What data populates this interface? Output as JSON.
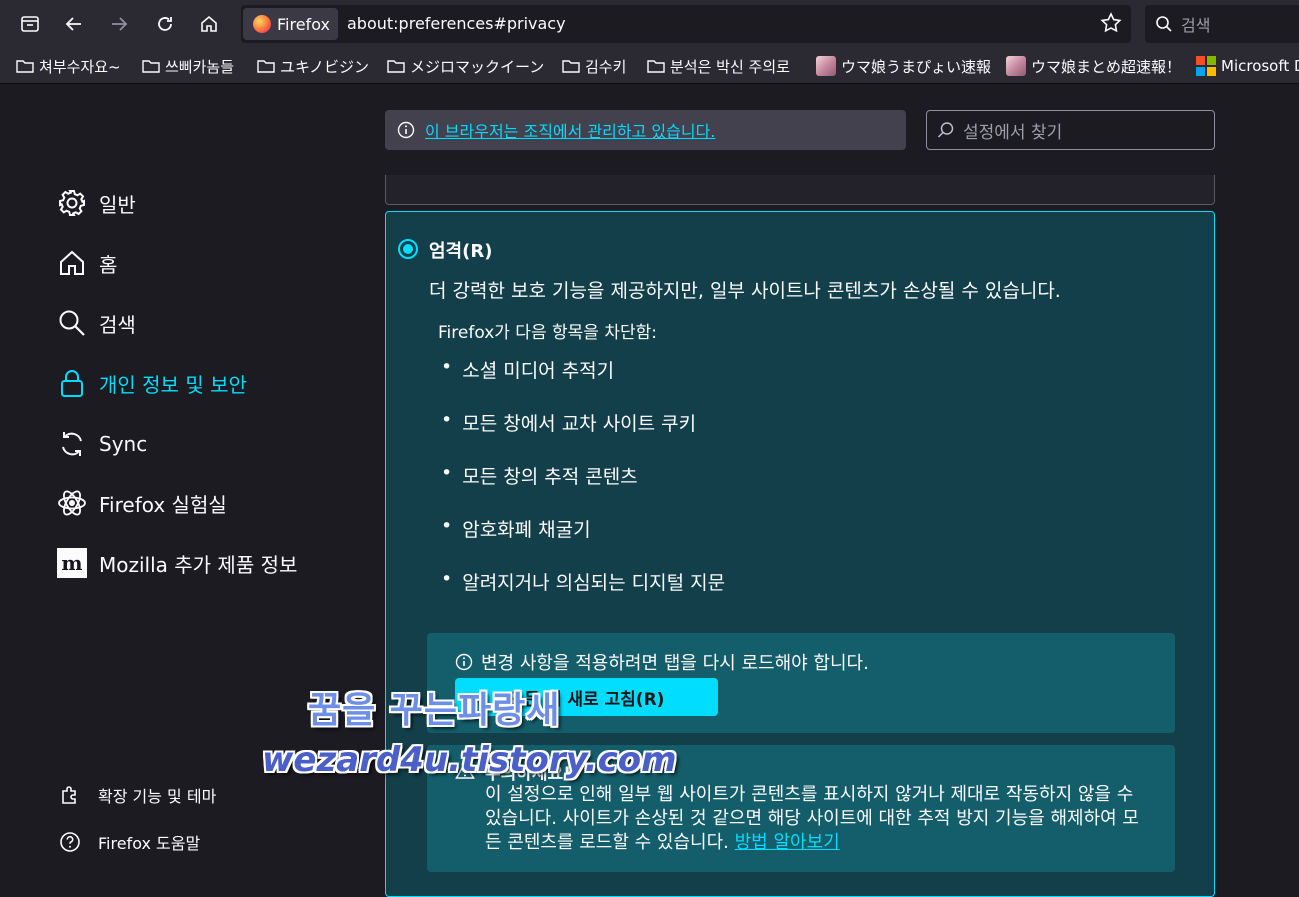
{
  "browser": {
    "identity_label": "Firefox",
    "url": "about:preferences#privacy",
    "search_placeholder": "검색"
  },
  "bookmarks": [
    {
      "label": "쳐부수자요~",
      "icon": "folder-icon"
    },
    {
      "label": "쓰삐카놈들",
      "icon": "folder-icon"
    },
    {
      "label": "ユキノビジン",
      "icon": "folder-icon"
    },
    {
      "label": "メジロマックイーン",
      "icon": "folder-icon"
    },
    {
      "label": "김수키",
      "icon": "folder-icon"
    },
    {
      "label": "분석은 박신 주의로",
      "icon": "folder-icon"
    },
    {
      "label": "ウマ娘うまぴょい速報",
      "icon": "favicon"
    },
    {
      "label": "ウマ娘まとめ超速報！",
      "icon": "favicon"
    },
    {
      "label": "Microsoft D",
      "icon": "microsoft-icon"
    }
  ],
  "policy_notice": "이 브라우저는 조직에서 관리하고 있습니다.",
  "pref_search_placeholder": "설정에서 찾기",
  "nav": {
    "items": [
      {
        "label": "일반",
        "icon": "gear-icon"
      },
      {
        "label": "홈",
        "icon": "home-icon"
      },
      {
        "label": "검색",
        "icon": "search-icon"
      },
      {
        "label": "개인 정보 및 보안",
        "icon": "lock-icon",
        "active": true
      },
      {
        "label": "Sync",
        "icon": "sync-icon"
      },
      {
        "label": "Firefox 실험실",
        "icon": "labs-icon"
      },
      {
        "label": "Mozilla 추가 제품 정보",
        "icon": "mozilla-icon"
      }
    ],
    "footer": [
      {
        "label": "확장 기능 및 테마",
        "icon": "puzzle-icon"
      },
      {
        "label": "Firefox 도움말",
        "icon": "help-icon"
      }
    ]
  },
  "strict": {
    "title": "엄격(R)",
    "description": "더 강력한 보호 기능을 제공하지만, 일부 사이트나 콘텐츠가 손상될 수 있습니다.",
    "blocks_title": "Firefox가 다음 항목을 차단함:",
    "blocks": [
      "소셜 미디어 추적기",
      "모든 창에서 교차 사이트 쿠키",
      "모든 창의 추적 콘텐츠",
      "암호화폐 채굴기",
      "알려지거나 의심되는 디지털 지문"
    ],
    "reload_message": "변경 사항을 적용하려면 탭을 다시 로드해야 합니다.",
    "reload_button": "모든 탭 새로 고침(R)",
    "warning_title": "주의하세요!",
    "warning_text": "이 설정으로 인해 일부 웹 사이트가 콘텐츠를 표시하지 않거나 제대로 작동하지 않을 수 있습니다. 사이트가 손상된 것 같으면 해당 사이트에 대한 추적 방지 기능을 해제하여 모든 콘텐츠를 로드할 수 있습니다.",
    "learn_more": "방법 알아보기"
  },
  "watermark": {
    "line1": "꿈을 꾸는파랑새",
    "line2": "wezard4u.tistory.com"
  },
  "colors": {
    "accent": "#00ddff",
    "card_bg": "#123f4a",
    "notice_bg": "#145e6b"
  }
}
